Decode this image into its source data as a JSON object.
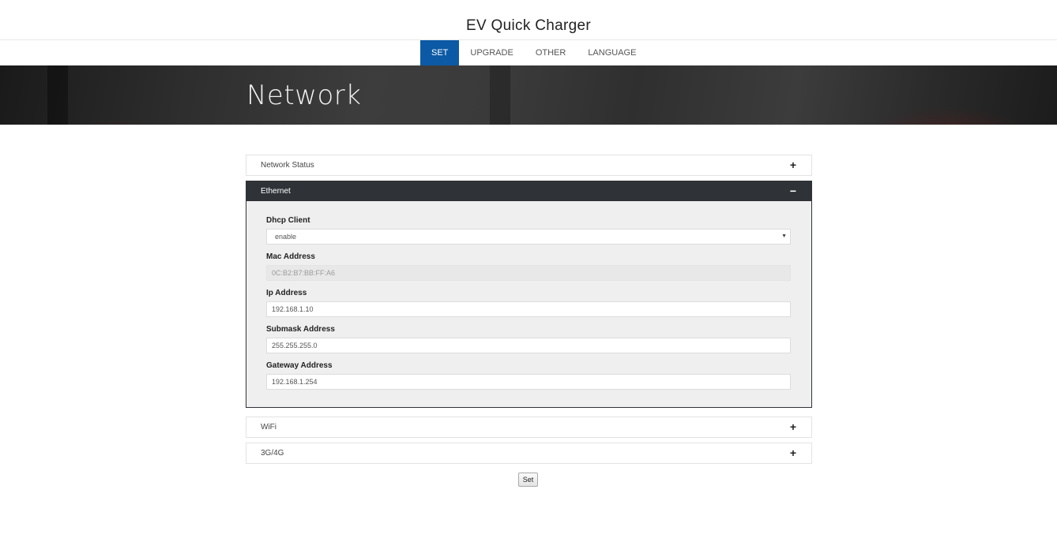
{
  "site": {
    "title": "EV Quick Charger"
  },
  "nav": {
    "items": [
      {
        "label": "SET",
        "active": true
      },
      {
        "label": "UPGRADE",
        "active": false
      },
      {
        "label": "OTHER",
        "active": false
      },
      {
        "label": "LANGUAGE",
        "active": false
      }
    ],
    "active_color": "#0c5aa6"
  },
  "hero": {
    "title": "Network"
  },
  "panels": {
    "network_status": {
      "title": "Network Status",
      "toggle": "+"
    },
    "ethernet": {
      "title": "Ethernet",
      "toggle": "−",
      "dhcp_label": "Dhcp Client",
      "dhcp_value": "enable",
      "dhcp_arrow": "▼",
      "mac_label": "Mac Address",
      "mac_value": "0C:B2:B7:BB:FF:A6",
      "ip_label": "Ip Address",
      "ip_value": "192.168.1.10",
      "submask_label": "Submask Address",
      "submask_value": "255.255.255.0",
      "gateway_label": "Gateway Address",
      "gateway_value": "192.168.1.254"
    },
    "wifi": {
      "title": "WiFi",
      "toggle": "+"
    },
    "mobile": {
      "title": "3G/4G",
      "toggle": "+"
    }
  },
  "actions": {
    "set_label": "Set"
  },
  "colors": {
    "header_dark": "#2f3338",
    "panel_body": "#efefef"
  }
}
